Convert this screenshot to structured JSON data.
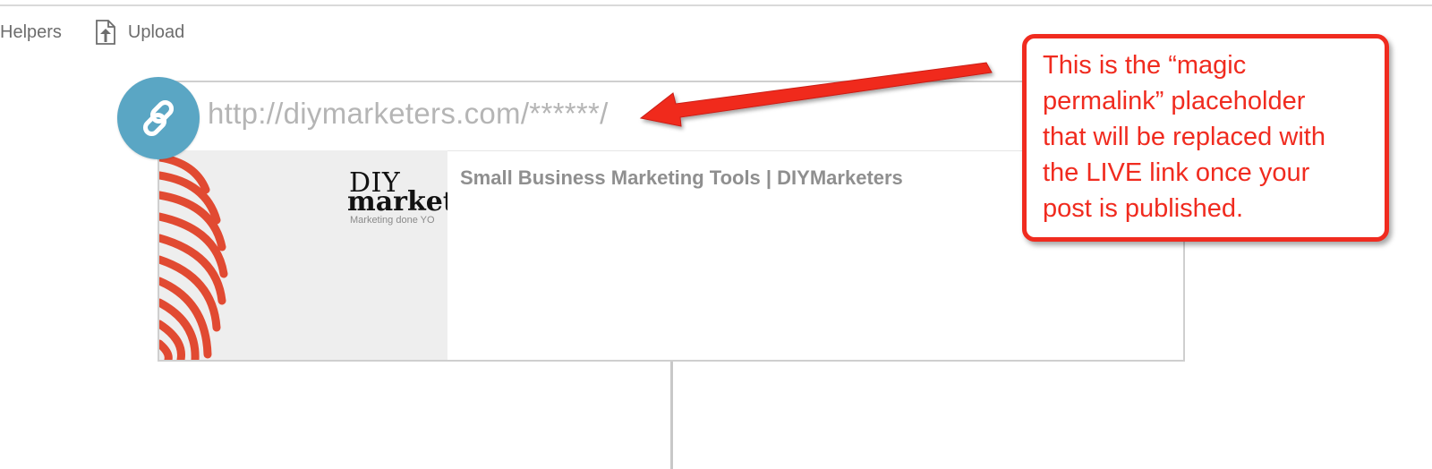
{
  "toolbar": {
    "helpers_label": "Helpers",
    "upload_label": "Upload"
  },
  "link_preview": {
    "url": "http://diymarketers.com/******/",
    "title": "Small Business Marketing Tools | DIYMarketers",
    "thumbnail": {
      "brand_line1": "DIY",
      "brand_line2": "market",
      "tagline": "Marketing done YO"
    }
  },
  "callout": {
    "text": "This is the “magic\npermalink” placeholder\nthat will be replaced with\nthe LIVE link once your\npost is published."
  },
  "colors": {
    "accent_red": "#f02b1f",
    "link_badge": "#5aa6c4",
    "thumb_stripes": "#e14a32"
  },
  "icons": {
    "upload": "upload-icon",
    "link": "link-icon"
  }
}
